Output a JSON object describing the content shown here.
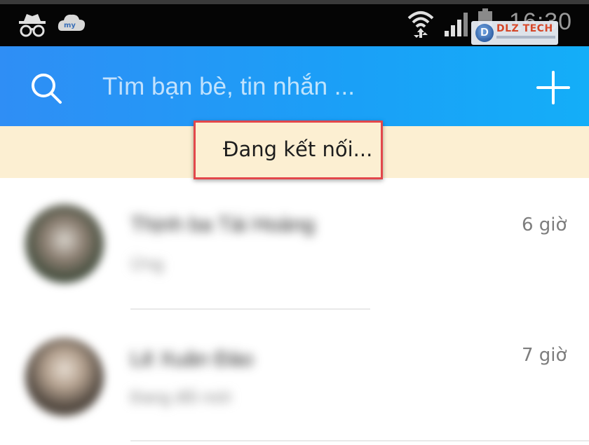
{
  "status_bar": {
    "clock": "16:30",
    "icons": [
      "incognito-icon",
      "my-cloud-icon",
      "wifi-icon",
      "signal-icon",
      "battery-icon"
    ],
    "background": "#050505"
  },
  "watermark": {
    "logo_letter": "D",
    "brand": "DLZ TECH"
  },
  "header": {
    "search_placeholder": "Tìm bạn bè, tin nhắn ...",
    "background_start": "#2f8ef5",
    "background_end": "#14aef8",
    "icons": [
      "search-icon",
      "add-icon"
    ]
  },
  "connection_banner": {
    "text": "Đang kết nối...",
    "background": "#fcefd2",
    "highlight_color": "#e2474b"
  },
  "chats": [
    {
      "name": "Thịnh ba Tài Hoàng",
      "preview": "Ừng",
      "time": "6 giờ"
    },
    {
      "name": "Lê Xuân Đào",
      "preview": "Đang đổi mới",
      "time": "7 giờ"
    }
  ]
}
